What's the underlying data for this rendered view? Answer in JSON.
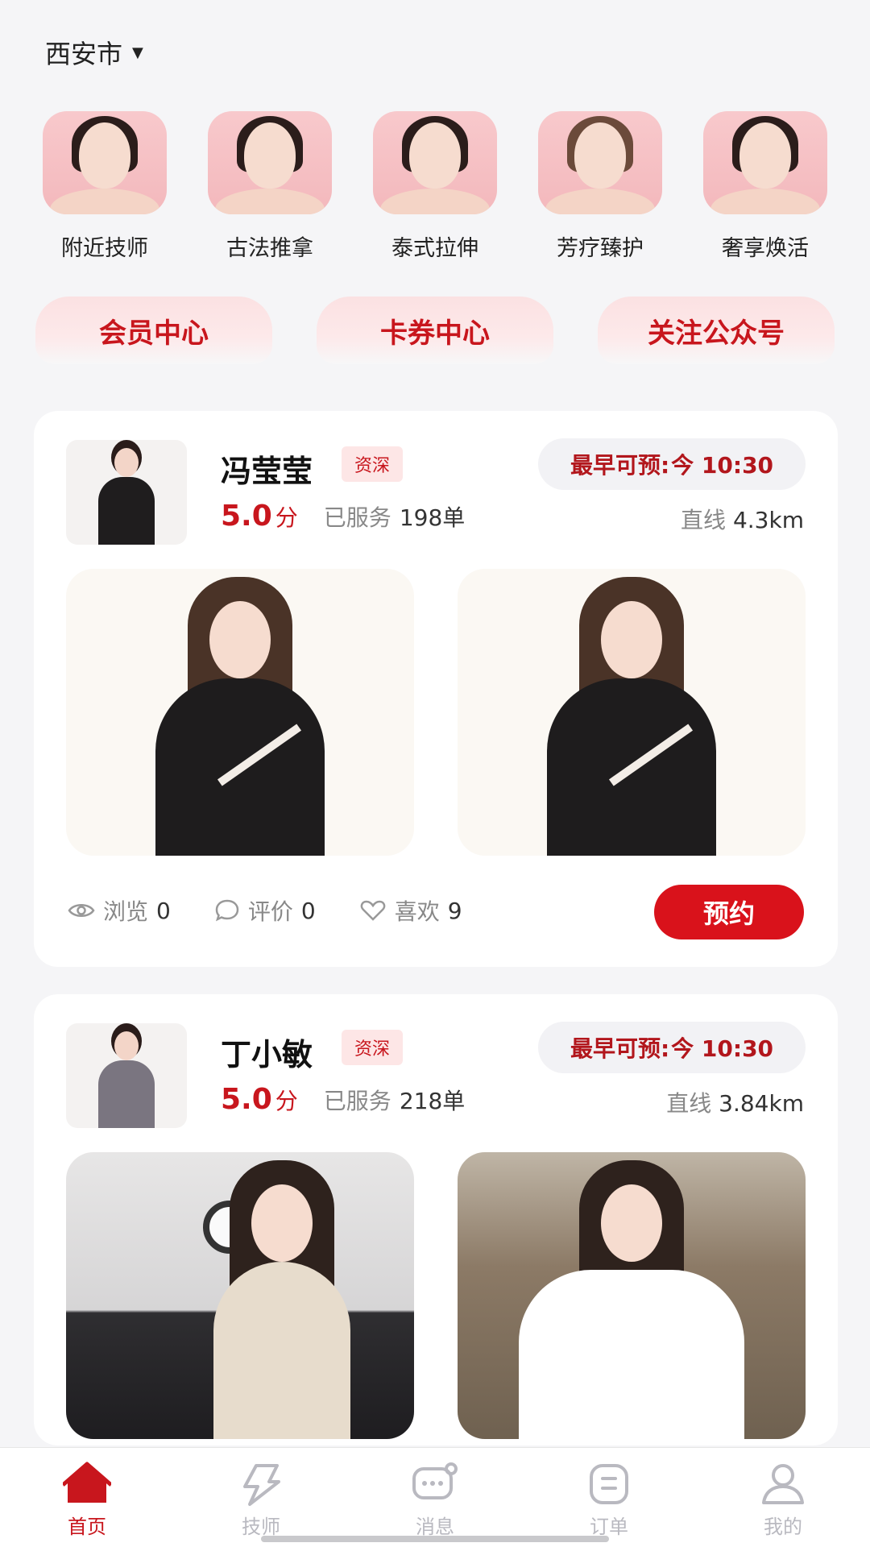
{
  "location": {
    "city": "西安市"
  },
  "categories": [
    {
      "label": "附近技师"
    },
    {
      "label": "古法推拿"
    },
    {
      "label": "泰式拉伸"
    },
    {
      "label": "芳疗臻护"
    },
    {
      "label": "奢享焕活"
    }
  ],
  "quick_links": [
    {
      "label": "会员中心"
    },
    {
      "label": "卡券中心"
    },
    {
      "label": "关注公众号"
    }
  ],
  "cards": [
    {
      "name": "冯莹莹",
      "badge": "资深",
      "earliest_label": "最早可预:",
      "earliest_time": "今 10:30",
      "score": "5.0",
      "score_unit": "分",
      "served_label": "已服务",
      "served_count": "198单",
      "distance_label": "直线",
      "distance_value": "4.3km",
      "views_label": "浏览",
      "views": "0",
      "reviews_label": "评价",
      "reviews": "0",
      "likes_label": "喜欢",
      "likes": "9",
      "book_label": "预约"
    },
    {
      "name": "丁小敏",
      "badge": "资深",
      "earliest_label": "最早可预:",
      "earliest_time": "今 10:30",
      "score": "5.0",
      "score_unit": "分",
      "served_label": "已服务",
      "served_count": "218单",
      "distance_label": "直线",
      "distance_value": "3.84km"
    }
  ],
  "tabbar": [
    {
      "label": "首页",
      "icon": "home-icon",
      "active": true
    },
    {
      "label": "技师",
      "icon": "lightning-icon"
    },
    {
      "label": "消息",
      "icon": "message-icon"
    },
    {
      "label": "订单",
      "icon": "order-icon"
    },
    {
      "label": "我的",
      "icon": "profile-icon"
    }
  ],
  "colors": {
    "brand": "#c8161d",
    "book_button": "#d9121b",
    "inactive_tab": "#b9b9c0"
  }
}
